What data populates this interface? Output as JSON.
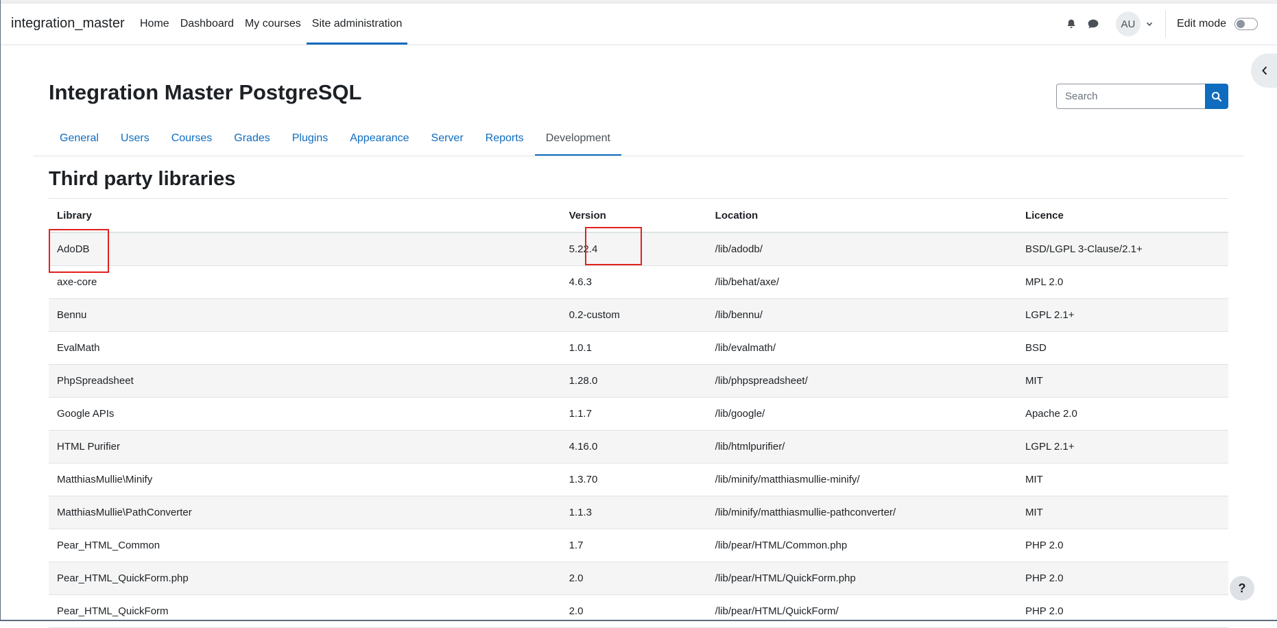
{
  "brand": "integration_master",
  "primary_nav": [
    {
      "label": "Home"
    },
    {
      "label": "Dashboard"
    },
    {
      "label": "My courses"
    },
    {
      "label": "Site administration",
      "active": true
    }
  ],
  "user": {
    "initials": "AU"
  },
  "edit_mode": {
    "label": "Edit mode",
    "on": false
  },
  "page_title": "Integration Master PostgreSQL",
  "search": {
    "placeholder": "Search"
  },
  "admin_tabs": [
    {
      "label": "General"
    },
    {
      "label": "Users"
    },
    {
      "label": "Courses"
    },
    {
      "label": "Grades"
    },
    {
      "label": "Plugins"
    },
    {
      "label": "Appearance"
    },
    {
      "label": "Server"
    },
    {
      "label": "Reports"
    },
    {
      "label": "Development",
      "active": true
    }
  ],
  "section_title": "Third party libraries",
  "table": {
    "headers": [
      "Library",
      "Version",
      "Location",
      "Licence"
    ],
    "rows": [
      [
        "AdoDB",
        "5.22.4",
        "/lib/adodb/",
        "BSD/LGPL 3-Clause/2.1+"
      ],
      [
        "axe-core",
        "4.6.3",
        "/lib/behat/axe/",
        "MPL 2.0"
      ],
      [
        "Bennu",
        "0.2-custom",
        "/lib/bennu/",
        "LGPL 2.1+"
      ],
      [
        "EvalMath",
        "1.0.1",
        "/lib/evalmath/",
        "BSD"
      ],
      [
        "PhpSpreadsheet",
        "1.28.0",
        "/lib/phpspreadsheet/",
        "MIT"
      ],
      [
        "Google APIs",
        "1.1.7",
        "/lib/google/",
        "Apache 2.0"
      ],
      [
        "HTML Purifier",
        "4.16.0",
        "/lib/htmlpurifier/",
        "LGPL 2.1+"
      ],
      [
        "MatthiasMullie\\Minify",
        "1.3.70",
        "/lib/minify/matthiasmullie-minify/",
        "MIT"
      ],
      [
        "MatthiasMullie\\PathConverter",
        "1.1.3",
        "/lib/minify/matthiasmullie-pathconverter/",
        "MIT"
      ],
      [
        "Pear_HTML_Common",
        "1.7",
        "/lib/pear/HTML/Common.php",
        "PHP 2.0"
      ],
      [
        "Pear_HTML_QuickForm.php",
        "2.0",
        "/lib/pear/HTML/QuickForm.php",
        "PHP 2.0"
      ],
      [
        "Pear_HTML_QuickForm",
        "2.0",
        "/lib/pear/HTML/QuickForm/",
        "PHP 2.0"
      ]
    ]
  },
  "highlight_color": "#e0201c",
  "accent_color": "#0f6cbf",
  "icons": [
    "bell-icon",
    "chat-icon",
    "chevron-down-icon",
    "chevron-left-icon",
    "search-icon",
    "help-icon"
  ],
  "help_label": "?"
}
